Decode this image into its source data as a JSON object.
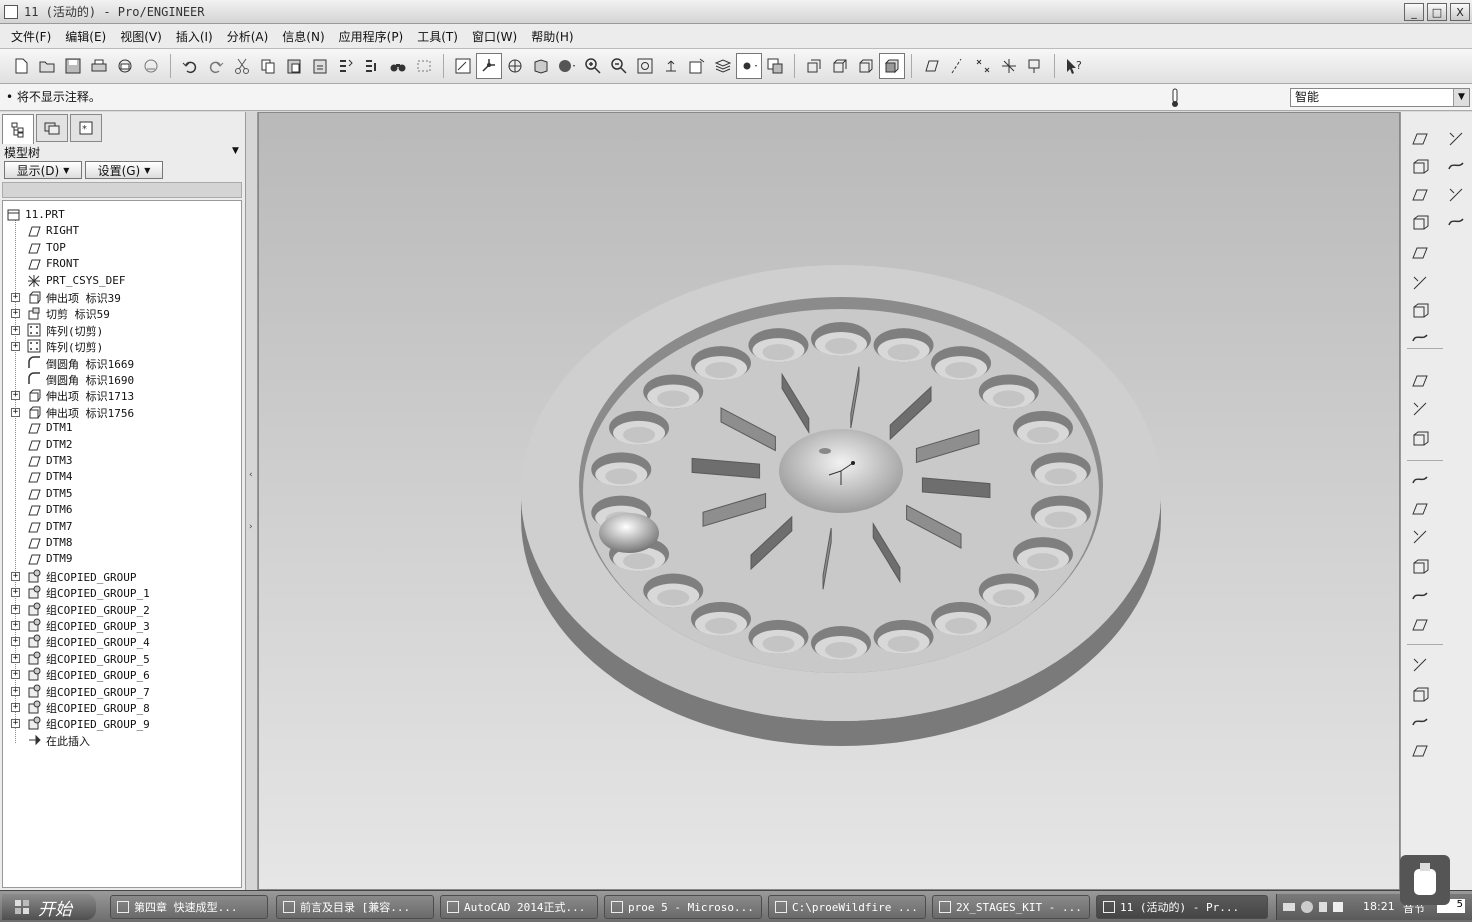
{
  "window": {
    "title": "11 (活动的) - Pro/ENGINEER",
    "buttons": [
      "_",
      "□",
      "X"
    ]
  },
  "menu": [
    "文件(F)",
    "编辑(E)",
    "视图(V)",
    "插入(I)",
    "分析(A)",
    "信息(N)",
    "应用程序(P)",
    "工具(T)",
    "窗口(W)",
    "帮助(H)"
  ],
  "message": {
    "text": "• 将不显示注释。"
  },
  "filter": {
    "value": "智能"
  },
  "panel": {
    "title": "模型树",
    "show_btn": "显示(D)",
    "settings_btn": "设置(G)"
  },
  "tree": [
    {
      "label": "11.PRT",
      "icon": "part-icon",
      "exp": false
    },
    {
      "label": "RIGHT",
      "icon": "datum-plane-icon",
      "exp": false
    },
    {
      "label": "TOP",
      "icon": "datum-plane-icon",
      "exp": false
    },
    {
      "label": "FRONT",
      "icon": "datum-plane-icon",
      "exp": false
    },
    {
      "label": "PRT_CSYS_DEF",
      "icon": "csys-icon",
      "exp": false
    },
    {
      "label": "伸出项 标识39",
      "icon": "extrude-icon",
      "exp": true
    },
    {
      "label": "切剪 标识59",
      "icon": "cut-icon",
      "exp": true
    },
    {
      "label": "阵列(切剪)",
      "icon": "pattern-icon",
      "exp": true
    },
    {
      "label": "阵列(切剪)",
      "icon": "pattern-icon",
      "exp": true
    },
    {
      "label": "倒圆角 标识1669",
      "icon": "round-icon",
      "exp": false
    },
    {
      "label": "倒圆角 标识1690",
      "icon": "round-icon",
      "exp": false
    },
    {
      "label": "伸出项 标识1713",
      "icon": "extrude-icon",
      "exp": true
    },
    {
      "label": "伸出项 标识1756",
      "icon": "extrude-icon",
      "exp": true
    },
    {
      "label": "DTM1",
      "icon": "datum-plane-icon",
      "exp": false
    },
    {
      "label": "DTM2",
      "icon": "datum-plane-icon",
      "exp": false
    },
    {
      "label": "DTM3",
      "icon": "datum-plane-icon",
      "exp": false
    },
    {
      "label": "DTM4",
      "icon": "datum-plane-icon",
      "exp": false
    },
    {
      "label": "DTM5",
      "icon": "datum-plane-icon",
      "exp": false
    },
    {
      "label": "DTM6",
      "icon": "datum-plane-icon",
      "exp": false
    },
    {
      "label": "DTM7",
      "icon": "datum-plane-icon",
      "exp": false
    },
    {
      "label": "DTM8",
      "icon": "datum-plane-icon",
      "exp": false
    },
    {
      "label": "DTM9",
      "icon": "datum-plane-icon",
      "exp": false
    },
    {
      "label": "组COPIED_GROUP",
      "icon": "group-icon",
      "exp": true
    },
    {
      "label": "组COPIED_GROUP_1",
      "icon": "group-icon",
      "exp": true
    },
    {
      "label": "组COPIED_GROUP_2",
      "icon": "group-icon",
      "exp": true
    },
    {
      "label": "组COPIED_GROUP_3",
      "icon": "group-icon",
      "exp": true
    },
    {
      "label": "组COPIED_GROUP_4",
      "icon": "group-icon",
      "exp": true
    },
    {
      "label": "组COPIED_GROUP_5",
      "icon": "group-icon",
      "exp": true
    },
    {
      "label": "组COPIED_GROUP_6",
      "icon": "group-icon",
      "exp": true
    },
    {
      "label": "组COPIED_GROUP_7",
      "icon": "group-icon",
      "exp": true
    },
    {
      "label": "组COPIED_GROUP_8",
      "icon": "group-icon",
      "exp": true
    },
    {
      "label": "组COPIED_GROUP_9",
      "icon": "group-icon",
      "exp": true
    },
    {
      "label": "在此插入",
      "icon": "insert-here-icon",
      "exp": false
    }
  ],
  "taskbar": {
    "start": "开始",
    "tasks": [
      {
        "label": "第四章 快速成型..."
      },
      {
        "label": "前言及目录 [兼容..."
      },
      {
        "label": "AutoCAD 2014正式..."
      },
      {
        "label": "proe 5 - Microso..."
      },
      {
        "label": "C:\\proeWildfire ..."
      },
      {
        "label": "2X_STAGES_KIT - ..."
      },
      {
        "label": "11 (活动的) - Pr..."
      }
    ],
    "clock": "18:21",
    "volume_label": "音节",
    "volume_value": "5"
  },
  "colors": {
    "viewport_top": "#b9b9b9",
    "viewport_bottom": "#e6e6e6",
    "taskbar": "#6d6d6d"
  }
}
